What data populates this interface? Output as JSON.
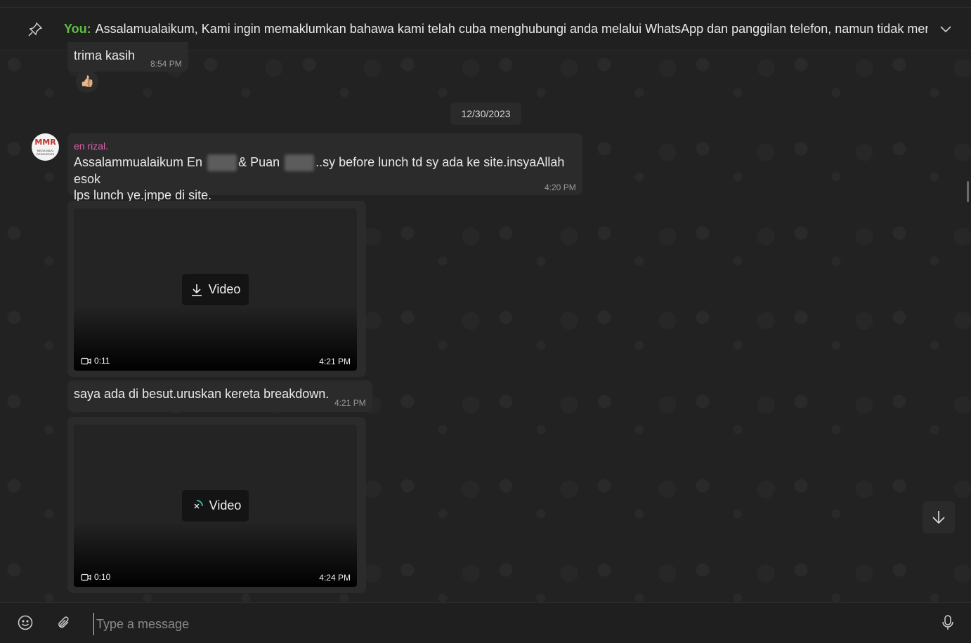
{
  "pinned": {
    "sender": "You:",
    "text": "Assalamualaikum,  Kami ingin memaklumkan bahawa kami telah cuba menghubungi anda melalui WhatsApp dan panggilan telefon, namun tidak mener..."
  },
  "messages": {
    "prev": {
      "text": "trima kasih",
      "time": "8:54 PM",
      "reaction": "👍🏼"
    },
    "date_divider": "12/30/2023",
    "rizal": {
      "sender": "en rizal.",
      "avatar_text": "MMR",
      "avatar_sub": "MEGA MAJU RESOURCES",
      "part1": "Assalammualaikum En",
      "part2": "& Puan",
      "part3": "..sy before lunch td sy ada ke site.insyaAllah esok",
      "line2": "lps lunch ye.jmpe di site.",
      "time": "4:20 PM"
    },
    "video1": {
      "label": "Video",
      "duration": "0:11",
      "time": "4:21 PM"
    },
    "text2": {
      "text": "saya ada di besut.uruskan kereta breakdown.",
      "time": "4:21 PM"
    },
    "video2": {
      "label": "Video",
      "duration": "0:10",
      "time": "4:24 PM"
    }
  },
  "composer": {
    "placeholder": "Type a message"
  }
}
